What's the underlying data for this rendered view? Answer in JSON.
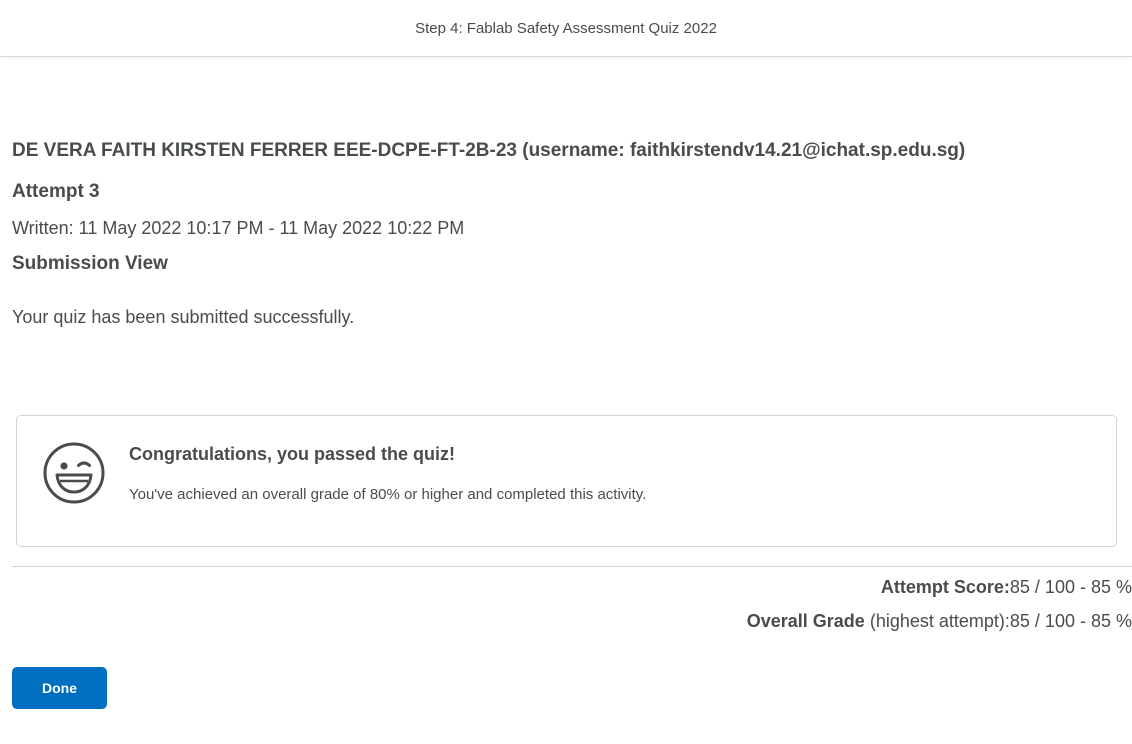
{
  "header": {
    "title": "Step 4: Fablab Safety Assessment Quiz 2022"
  },
  "submission": {
    "student": "DE VERA FAITH KIRSTEN FERRER EEE-DCPE-FT-2B-23 (username: faithkirstendv14.21@ichat.sp.edu.sg)",
    "attempt": "Attempt 3",
    "written": "Written: 11 May 2022 10:17 PM - 11 May 2022 10:22 PM",
    "view_title": "Submission View",
    "message": "Your quiz has been submitted successfully."
  },
  "result_card": {
    "icon": "smiley-icon",
    "title": "Congratulations, you passed the quiz!",
    "description": "You've achieved an overall grade of 80% or higher and completed this activity."
  },
  "scores": {
    "attempt_label": "Attempt Score:",
    "attempt_value": "85 / 100 - 85 %",
    "overall_label": "Overall Grade",
    "overall_sub": " (highest attempt):",
    "overall_value": "85 / 100 - 85 %"
  },
  "actions": {
    "done_label": "Done"
  },
  "colors": {
    "primary_button": "#006fbf",
    "text": "#494c4e",
    "border": "#cdd5dc"
  }
}
